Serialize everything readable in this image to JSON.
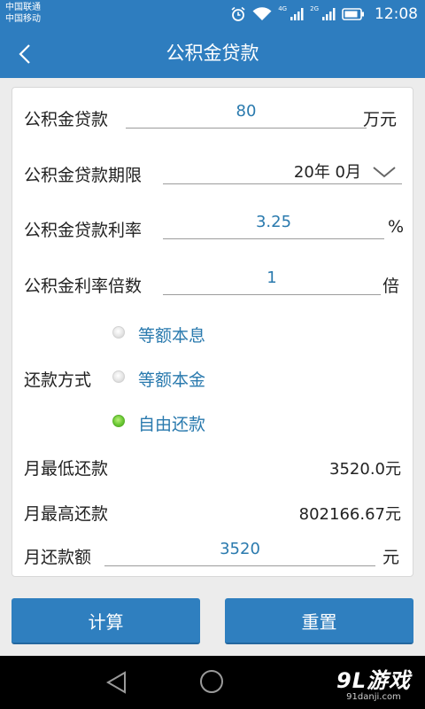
{
  "status_bar": {
    "carrier_1": "中国联通",
    "carrier_2": "中国移动",
    "net_1": "4G",
    "net_2": "2G",
    "time": "12:08"
  },
  "header": {
    "title": "公积金贷款"
  },
  "form": {
    "loan_amount": {
      "label": "公积金贷款",
      "value": "80",
      "unit": "万元"
    },
    "loan_term": {
      "label": "公积金贷款期限",
      "value": "20年 0月"
    },
    "interest_rate": {
      "label": "公积金贷款利率",
      "value": "3.25",
      "unit": "%"
    },
    "rate_multiplier": {
      "label": "公积金利率倍数",
      "value": "1",
      "unit": "倍"
    },
    "repayment_method": {
      "label": "还款方式",
      "options": [
        "等额本息",
        "等额本金",
        "自由还款"
      ],
      "selected": "自由还款"
    },
    "min_monthly": {
      "label": "月最低还款",
      "value": "3520.0元"
    },
    "max_monthly": {
      "label": "月最高还款",
      "value": "802166.67元"
    },
    "monthly_payment": {
      "label": "月还款额",
      "value": "3520",
      "unit": "元"
    }
  },
  "buttons": {
    "calculate": "计算",
    "reset": "重置"
  },
  "watermark": {
    "brand": "9L游戏",
    "url": "91danji.com"
  },
  "colors": {
    "primary": "#2e7dbf",
    "value_text": "#2a7aae",
    "radio_checked": "#6cc935",
    "background": "#ececec"
  }
}
